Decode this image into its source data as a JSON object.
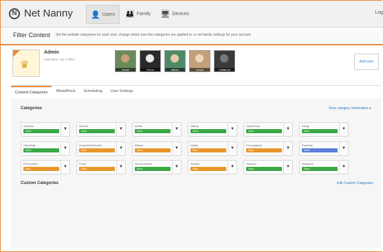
{
  "header": {
    "brand": "Net Nanny",
    "logo_mark": "N",
    "nav": [
      {
        "label": "Users",
        "icon": "user-icon",
        "glyph": "👤",
        "active": true
      },
      {
        "label": "Family",
        "icon": "family-icon",
        "glyph": "👪",
        "active": false
      },
      {
        "label": "Devices",
        "icon": "devices-icon",
        "glyph": "🖥",
        "active": false
      }
    ],
    "logout": "Log"
  },
  "filter": {
    "title": "Filter Content",
    "description": "Set the website categories for each user, change which user the categories are applied to, or set family settings for your account."
  },
  "admin": {
    "name": "Admin",
    "last_seen": "Last Seen: Apr 3 2013"
  },
  "users": [
    {
      "label": "Austin"
    },
    {
      "label": "Trevor"
    },
    {
      "label": "Allison"
    },
    {
      "label": "Susan"
    },
    {
      "label": "Unfiltered"
    }
  ],
  "add_user": "Add User",
  "tabs": [
    {
      "label": "Content Categories",
      "active": true
    },
    {
      "label": "Allow/Block",
      "active": false
    },
    {
      "label": "Scheduling",
      "active": false
    },
    {
      "label": "User Settings",
      "active": false
    }
  ],
  "categories_title": "Categories",
  "category_info_link": "View category information",
  "categories": [
    {
      "name": "Abortion",
      "status": "Allow",
      "color": "#3aa845"
    },
    {
      "name": "Alcohol",
      "status": "Allow",
      "color": "#3aa845"
    },
    {
      "name": "Anime",
      "status": "Allow",
      "color": "#3aa845"
    },
    {
      "name": "Dating",
      "status": "Allow",
      "color": "#3aa845"
    },
    {
      "name": "Death/Gore",
      "status": "Allow",
      "color": "#3aa845"
    },
    {
      "name": "Drugs",
      "status": "Allow",
      "color": "#3aa845"
    },
    {
      "name": "Gambling",
      "status": "Allow",
      "color": "#3aa845"
    },
    {
      "name": "Lingerie/Swimsuits",
      "status": "Warn",
      "color": "#e8962a"
    },
    {
      "name": "Mature",
      "status": "Warn",
      "color": "#e8962a"
    },
    {
      "name": "Nudity",
      "status": "Warn",
      "color": "#e8962a"
    },
    {
      "name": "Pornography",
      "status": "Warn",
      "color": "#e8962a"
    },
    {
      "name": "Profanity",
      "status": "Mask",
      "color": "#5b7fd8"
    },
    {
      "name": "Provocative",
      "status": "Warn",
      "color": "#e8962a"
    },
    {
      "name": "Proxy",
      "status": "Warn",
      "color": "#e8962a"
    },
    {
      "name": "Sexual Health",
      "status": "Allow",
      "color": "#3aa845"
    },
    {
      "name": "Suicide",
      "status": "Warn",
      "color": "#e8962a"
    },
    {
      "name": "Tobacco",
      "status": "Allow",
      "color": "#3aa845"
    },
    {
      "name": "Weapons",
      "status": "Allow",
      "color": "#3aa845"
    }
  ],
  "custom_categories_title": "Custom Categories",
  "edit_custom_link": "Edit Custom Categories"
}
